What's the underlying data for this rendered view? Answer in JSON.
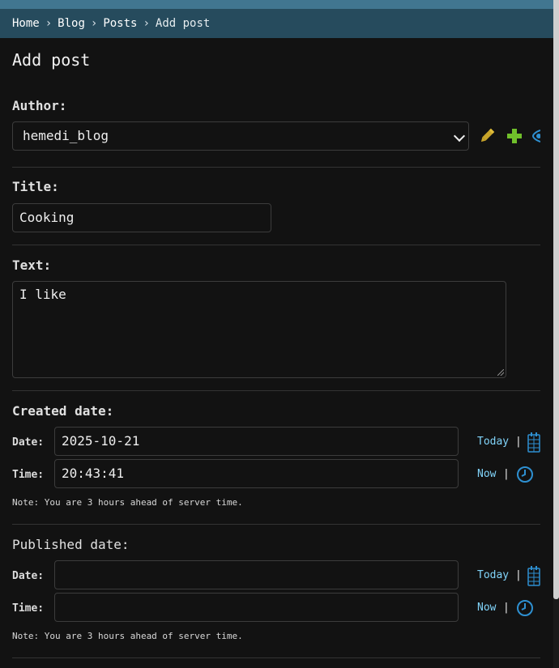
{
  "breadcrumbs": {
    "items": [
      "Home",
      "Blog",
      "Posts"
    ],
    "separator": "›",
    "current": "Add post"
  },
  "page": {
    "title": "Add post"
  },
  "author": {
    "label": "Author:",
    "selected": "hemedi_blog",
    "icons": [
      "pencil-icon",
      "plus-icon",
      "eye-icon"
    ]
  },
  "title_field": {
    "label": "Title:",
    "value": "Cooking"
  },
  "text_field": {
    "label": "Text:",
    "value": "I like"
  },
  "created": {
    "label": "Created date:",
    "date_label": "Date:",
    "date_value": "2025-10-21",
    "time_label": "Time:",
    "time_value": "20:43:41",
    "today": "Today",
    "now": "Now",
    "pipe": "|",
    "note": "Note: You are 3 hours ahead of server time."
  },
  "published": {
    "label": "Published date:",
    "date_label": "Date:",
    "date_value": "",
    "time_label": "Time:",
    "time_value": "",
    "today": "Today",
    "now": "Now",
    "pipe": "|",
    "note": "Note: You are 3 hours ahead of server time."
  },
  "colors": {
    "header": "#264b5d",
    "topbar": "#417690",
    "link": "#81d4fa",
    "add": "#70bf2b",
    "edit": "#c8a42a",
    "view": "#2e90d1"
  }
}
